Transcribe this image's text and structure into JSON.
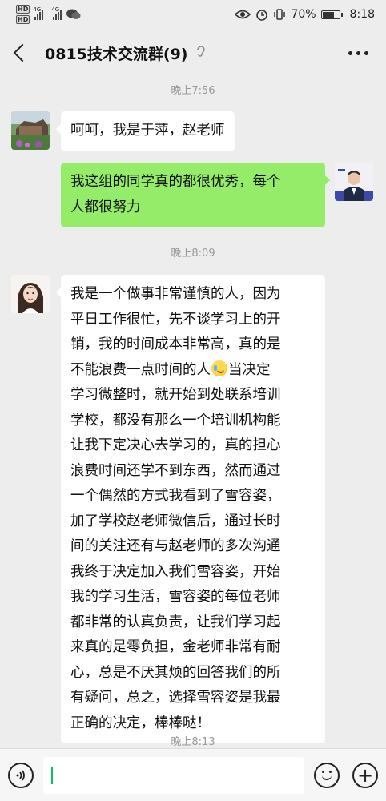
{
  "status_bar": {
    "network_left": "HD",
    "network_right": "HD",
    "signal_1": "4G",
    "signal_2": "4G",
    "battery": "70%",
    "time": "8:18"
  },
  "header": {
    "title": "0815技术交流群(9)"
  },
  "messages": [
    {
      "type": "time",
      "text": "晚上7:56"
    },
    {
      "type": "in",
      "lines": [
        "呵呵，我是于萍，赵老师"
      ]
    },
    {
      "type": "out",
      "lines": [
        "我这组的同学真的都很优秀，每个",
        "人都很努力"
      ]
    },
    {
      "type": "time",
      "text": "晚上8:09"
    },
    {
      "type": "in",
      "lines": [
        "我是一个做事非常谨慎的人，因为",
        "平日工作很忙，先不谈学习上的开",
        "销，我的时间成本非常高，真的是",
        "不能浪费一点时间的人",
        "当决定",
        "学习微整时，就开始到处联系培训",
        "学校，都没有那么一个培训机构能",
        "让我下定决心去学习的，真的担心",
        "浪费时间还学不到东西，然而通过",
        "一个偶然的方式我看到了雪容姿，",
        "加了学校赵老师微信后，通过长时",
        "间的关注还有与赵老师的多次沟通",
        "我终于决定加入我们雪容姿，开始",
        "我的学习生活，雪容姿的每位老师",
        "都非常的认真负责，让我们学习起",
        "来真的是零负担，金老师非常有耐",
        "心，总是不厌其烦的回答我们的所",
        "有疑问，总之，选择雪容姿是我最",
        "正确的决定，棒棒哒！"
      ]
    },
    {
      "type": "time",
      "text": "晚上8:13"
    }
  ],
  "input": {
    "value": ""
  },
  "icons": {
    "back": "back-arrow-icon",
    "more": "more-icon",
    "voice": "voice-icon",
    "emoji": "emoji-icon",
    "plus": "plus-icon",
    "inline_emoji": "laughing-crying-emoji-icon"
  },
  "colors": {
    "background": "#ededed",
    "outgoing_bubble": "#95ec69",
    "incoming_bubble": "#ffffff",
    "accent": "#07c160"
  }
}
